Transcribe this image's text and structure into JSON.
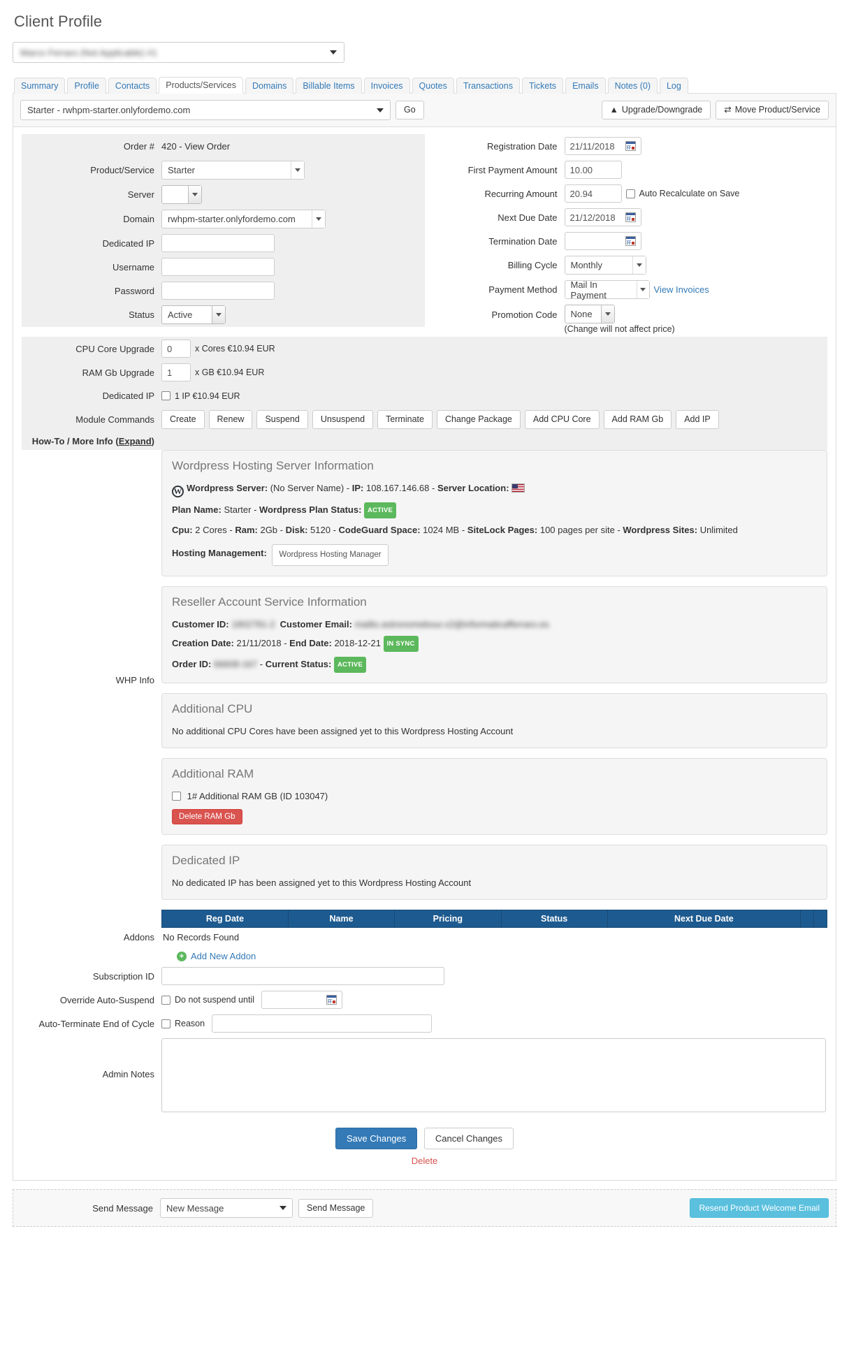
{
  "header": {
    "page_title": "Client Profile",
    "client_selector_value": "Marco Ferraro (Not Applicable) #1"
  },
  "tabs": [
    {
      "label": "Summary",
      "active": false
    },
    {
      "label": "Profile",
      "active": false
    },
    {
      "label": "Contacts",
      "active": false
    },
    {
      "label": "Products/Services",
      "active": true
    },
    {
      "label": "Domains",
      "active": false
    },
    {
      "label": "Billable Items",
      "active": false
    },
    {
      "label": "Invoices",
      "active": false
    },
    {
      "label": "Quotes",
      "active": false
    },
    {
      "label": "Transactions",
      "active": false
    },
    {
      "label": "Tickets",
      "active": false
    },
    {
      "label": "Emails",
      "active": false
    },
    {
      "label": "Notes (0)",
      "active": false
    },
    {
      "label": "Log",
      "active": false
    }
  ],
  "toolbar": {
    "product_selected": "Starter - rwhpm-starter.onlyfordemo.com",
    "go_label": "Go",
    "upgrade_label": "Upgrade/Downgrade",
    "move_label": "Move Product/Service"
  },
  "form_left": {
    "order_label": "Order #",
    "order_value": "420 - View Order",
    "product_label": "Product/Service",
    "product_value": "Starter",
    "server_label": "Server",
    "server_value": "",
    "domain_label": "Domain",
    "domain_value": "rwhpm-starter.onlyfordemo.com",
    "dedicated_ip_label": "Dedicated IP",
    "dedicated_ip_value": "",
    "username_label": "Username",
    "username_value": "",
    "password_label": "Password",
    "password_value": "",
    "status_label": "Status",
    "status_value": "Active"
  },
  "form_right": {
    "reg_date_label": "Registration Date",
    "reg_date_value": "21/11/2018",
    "first_payment_label": "First Payment Amount",
    "first_payment_value": "10.00",
    "recurring_label": "Recurring Amount",
    "recurring_value": "20.94",
    "auto_recalc_label": "Auto Recalculate on Save",
    "next_due_label": "Next Due Date",
    "next_due_value": "21/12/2018",
    "termination_label": "Termination Date",
    "termination_value": "",
    "billing_cycle_label": "Billing Cycle",
    "billing_cycle_value": "Monthly",
    "payment_method_label": "Payment Method",
    "payment_method_value": "Mail In Payment",
    "view_invoices_label": "View Invoices",
    "promotion_label": "Promotion Code",
    "promotion_value": "None",
    "promotion_note": "(Change will not affect price)"
  },
  "upgrades": {
    "cpu_label": "CPU Core Upgrade",
    "cpu_value": "0",
    "cpu_suffix": "x Cores €10.94 EUR",
    "ram_label": "RAM Gb Upgrade",
    "ram_value": "1",
    "ram_suffix": "x GB €10.94 EUR",
    "dedip_label": "Dedicated IP",
    "dedip_suffix": "1 IP €10.94 EUR"
  },
  "module_commands": {
    "label": "Module Commands",
    "buttons": [
      "Create",
      "Renew",
      "Suspend",
      "Unsuspend",
      "Terminate",
      "Change Package",
      "Add CPU Core",
      "Add RAM Gb",
      "Add IP"
    ]
  },
  "howto": {
    "label_prefix": "How-To / More Info (",
    "expand": "Expand",
    "label_suffix": ")"
  },
  "whp_info_label": "WHP Info",
  "wordpress_panel": {
    "title": "Wordpress Hosting Server Information",
    "server_label": "Wordpress Server:",
    "server_name": "(No Server Name)",
    "ip_label": "IP:",
    "ip_value": "108.167.146.68",
    "location_label": "Server Location:",
    "plan_name_label": "Plan Name:",
    "plan_name_value": "Starter",
    "plan_status_label": "Wordpress Plan Status:",
    "plan_status_badge": "ACTIVE",
    "cpu_label": "Cpu:",
    "cpu_value": "2 Cores",
    "ram_label": "Ram:",
    "ram_value": "2Gb",
    "disk_label": "Disk:",
    "disk_value": "5120",
    "codeguard_label": "CodeGuard Space:",
    "codeguard_value": "1024 MB",
    "sitelock_label": "SiteLock Pages:",
    "sitelock_value": "100 pages per site",
    "sites_label": "Wordpress Sites:",
    "sites_value": "Unlimited",
    "hosting_mgmt_label": "Hosting Management:",
    "hosting_mgmt_button": "Wordpress Hosting Manager"
  },
  "reseller_panel": {
    "title": "Reseller Account Service Information",
    "customer_id_label": "Customer ID:",
    "customer_id_value": "1802781-2",
    "customer_email_label": "Customer Email:",
    "customer_email_value": "mailto.astronomebour.x2@informaticafferraro.es",
    "creation_date_label": "Creation Date:",
    "creation_date_value": "21/11/2018",
    "end_date_label": "End Date:",
    "end_date_value": "2018-12-21",
    "sync_badge": "IN SYNC",
    "order_id_label": "Order ID:",
    "order_id_value": "66608-167",
    "current_status_label": "Current Status:",
    "current_status_badge": "ACTIVE"
  },
  "additional_cpu_panel": {
    "title": "Additional CPU",
    "empty_text": "No additional CPU Cores have been assigned yet to this Wordpress Hosting Account"
  },
  "additional_ram_panel": {
    "title": "Additional RAM",
    "item_label": "1# Additional RAM GB (ID 103047)",
    "delete_button": "Delete RAM Gb"
  },
  "dedicated_ip_panel": {
    "title": "Dedicated IP",
    "empty_text": "No dedicated IP has been assigned yet to this Wordpress Hosting Account"
  },
  "addons": {
    "label": "Addons",
    "columns": [
      "Reg Date",
      "Name",
      "Pricing",
      "Status",
      "Next Due Date"
    ],
    "empty_text": "No Records Found",
    "add_new_label": "Add New Addon"
  },
  "bottom_fields": {
    "subscription_label": "Subscription ID",
    "subscription_value": "",
    "override_label": "Override Auto-Suspend",
    "override_checkbox_text": "Do not suspend until",
    "override_date_value": "",
    "autoterm_label": "Auto-Terminate End of Cycle",
    "autoterm_checkbox_text": "Reason",
    "autoterm_reason_value": "",
    "admin_notes_label": "Admin Notes",
    "admin_notes_value": ""
  },
  "actions": {
    "save_label": "Save Changes",
    "cancel_label": "Cancel Changes",
    "delete_label": "Delete"
  },
  "send_message": {
    "label": "Send Message",
    "select_value": "New Message",
    "send_button": "Send Message",
    "resend_button": "Resend Product Welcome Email"
  },
  "colors": {
    "primary": "#337ab7",
    "success": "#5cb85c",
    "danger": "#d9534f",
    "table_header": "#1d5a8f"
  }
}
